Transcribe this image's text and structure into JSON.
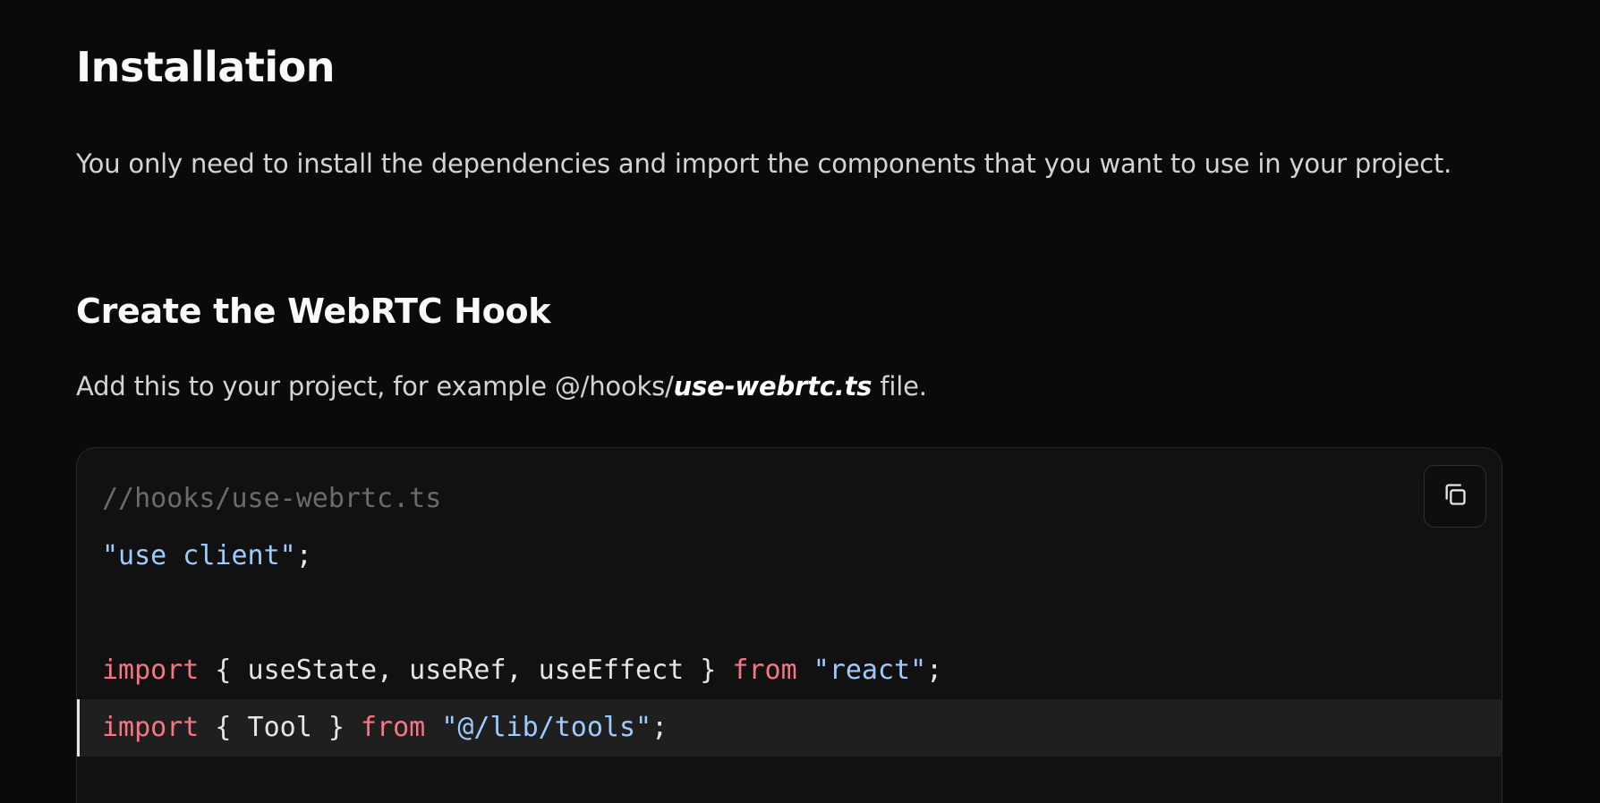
{
  "installation": {
    "title": "Installation",
    "intro": "You only need to install the dependencies and import the components that you want to use in your project."
  },
  "section": {
    "title": "Create the WebRTC Hook",
    "hint_prefix": "Add this to your project, for example @/hooks/",
    "hint_file": "use-webrtc.ts",
    "hint_suffix": " file."
  },
  "code": {
    "copy_icon": "copy-icon",
    "lines": [
      {
        "tokens": [
          {
            "type": "comment",
            "text": "//hooks/use-webrtc.ts"
          }
        ]
      },
      {
        "tokens": [
          {
            "type": "string",
            "text": "\"use client\""
          },
          {
            "type": "punct",
            "text": ";"
          }
        ]
      },
      {
        "tokens": []
      },
      {
        "tokens": [
          {
            "type": "keyword",
            "text": "import"
          },
          {
            "type": "ident",
            "text": " { useState, useRef, useEffect } "
          },
          {
            "type": "keyword",
            "text": "from"
          },
          {
            "type": "ident",
            "text": " "
          },
          {
            "type": "string",
            "text": "\"react\""
          },
          {
            "type": "punct",
            "text": ";"
          }
        ]
      },
      {
        "tokens": [
          {
            "type": "keyword",
            "text": "import"
          },
          {
            "type": "ident",
            "text": " { Tool } "
          },
          {
            "type": "keyword",
            "text": "from"
          },
          {
            "type": "ident",
            "text": " "
          },
          {
            "type": "string",
            "text": "\"@/lib/tools\""
          },
          {
            "type": "punct",
            "text": ";"
          }
        ],
        "highlighted": true
      }
    ]
  },
  "colors": {
    "background": "#0a0a0a",
    "code_background": "#111111",
    "highlight_background": "#1f1f1f",
    "keyword": "#f97583",
    "string": "#9ecbff",
    "comment": "#6b6b6b"
  }
}
